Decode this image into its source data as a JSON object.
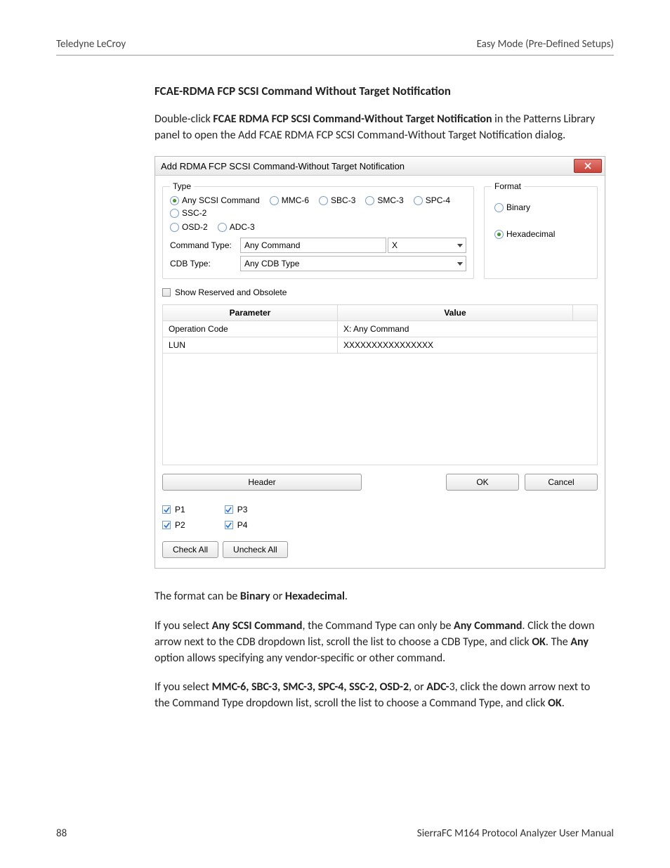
{
  "header": {
    "left": "Teledyne LeCroy",
    "right": "Easy Mode (Pre-Defined Setups)"
  },
  "section_title": "FCAE-RDMA FCP SCSI Command Without Target Notification",
  "intro": {
    "pre": "Double-click ",
    "bold": "FCAE RDMA FCP SCSI Command-Without Target Notification",
    "post": " in the Patterns Library panel to open the Add FCAE RDMA FCP SCSI Command-Without Target Notification dialog."
  },
  "dialog": {
    "title": "Add RDMA FCP SCSI Command-Without Target Notification",
    "type_legend": "Type",
    "type_options": [
      "Any SCSI Command",
      "MMC-6",
      "SBC-3",
      "SMC-3",
      "SPC-4",
      "SSC-2"
    ],
    "type_options_row2": [
      "OSD-2",
      "ADC-3"
    ],
    "type_selected": "Any SCSI Command",
    "format_legend": "Format",
    "format_options": [
      "Binary",
      "Hexadecimal"
    ],
    "format_selected": "Hexadecimal",
    "labels": {
      "command_type": "Command Type:",
      "cdb_type": "CDB Type:"
    },
    "command_type_value": "Any Command",
    "command_type_code": "X",
    "cdb_type_value": "Any CDB Type",
    "show_reserved_label": "Show Reserved and Obsolete",
    "table": {
      "headers": [
        "Parameter",
        "Value"
      ],
      "rows": [
        {
          "param": "Operation Code",
          "value": "X: Any Command"
        },
        {
          "param": "LUN",
          "value": "XXXXXXXXXXXXXXXX"
        }
      ]
    },
    "buttons": {
      "header": "Header",
      "ok": "OK",
      "cancel": "Cancel",
      "check_all": "Check All",
      "uncheck_all": "Uncheck All"
    },
    "ports": [
      "P1",
      "P2",
      "P3",
      "P4"
    ]
  },
  "body": {
    "p2": {
      "pre": "The format can be ",
      "b1": "Binary",
      "mid": " or ",
      "b2": "Hexadecimal",
      "post": "."
    },
    "p3": {
      "pre": "If you select ",
      "b1": "Any SCSI Command",
      "mid1": ", the Command Type can only be ",
      "b2": "Any Command",
      "mid2": ". Click the down arrow next to the CDB dropdown list, scroll the list to choose a CDB Type, and click ",
      "b3": "OK",
      "mid3": ". The ",
      "b4": "Any",
      "post": " option allows specifying any vendor-specific or other command."
    },
    "p4": {
      "pre": "If you select ",
      "b1": "MMC-6, SBC-3, SMC-3, SPC-4, SSC-2, OSD-2",
      "mid1": ", or ",
      "b2": "ADC-",
      "num": "3",
      "mid2": ", click the down arrow next to the Command Type dropdown list, scroll the list to choose a Command Type, and click ",
      "b3": "OK",
      "post": "."
    }
  },
  "footer": {
    "page": "88",
    "manual": "SierraFC M164 Protocol Analyzer User Manual"
  }
}
